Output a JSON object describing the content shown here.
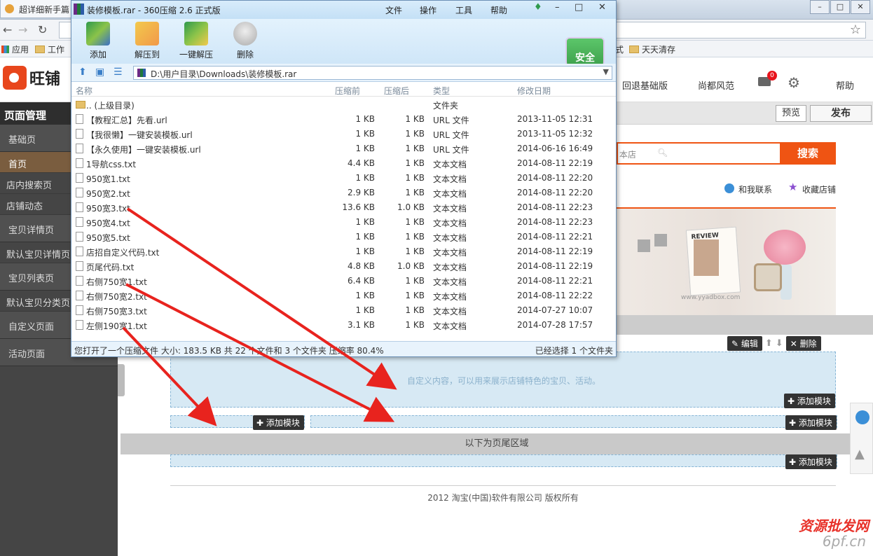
{
  "browser": {
    "tab_title": "超详细新手篇",
    "url": "",
    "bookmarks": [
      {
        "label": "应用"
      },
      {
        "label": "工作"
      },
      {
        "label": "式"
      },
      {
        "label": "天天清存"
      }
    ],
    "window_controls": [
      "–",
      "□",
      "✕"
    ]
  },
  "app": {
    "logo_text": "旺铺",
    "header_links": [
      "回退基础版",
      "尚都风范",
      "帮助"
    ],
    "mail_badge": "0",
    "preview_label": "预览",
    "publish_label": "发布"
  },
  "sidebar": {
    "title": "页面管理",
    "items": [
      {
        "label": "基础页",
        "kind": "group"
      },
      {
        "label": "首页",
        "kind": "active"
      },
      {
        "label": "店内搜索页",
        "kind": "sub"
      },
      {
        "label": "店铺动态",
        "kind": "sub"
      },
      {
        "label": "宝贝详情页",
        "kind": "group"
      },
      {
        "label": "默认宝贝详情页",
        "kind": "sub"
      },
      {
        "label": "宝贝列表页",
        "kind": "group"
      },
      {
        "label": "默认宝贝分类页",
        "kind": "sub"
      },
      {
        "label": "自定义页面",
        "kind": "group"
      },
      {
        "label": "活动页面",
        "kind": "group"
      }
    ]
  },
  "store": {
    "search_scope": "本店",
    "search_button": "搜索",
    "contact_label": "和我联系",
    "favorite_label": "收藏店铺",
    "banner_card_text": "REVIEW",
    "banner_watermark": "www.yyadbox.com"
  },
  "modules": {
    "edit_label": "编辑",
    "delete_label": "删除",
    "custom_text": "自定义内容，可以用来展示店铺特色的宝贝、活动。",
    "add_module_label": "添加模块",
    "footer_band": "以下为页尾区域",
    "copyright": "2012 淘宝(中国)软件有限公司 版权所有"
  },
  "watermark": {
    "line1": "资源批发网",
    "line2": "6pf.cn"
  },
  "zip": {
    "title": "装修模板.rar - 360压缩 2.6 正式版",
    "menu": [
      "文件",
      "操作",
      "工具",
      "帮助"
    ],
    "window_buttons": [
      "♦",
      "–",
      "□",
      "✕"
    ],
    "tools": [
      "添加",
      "解压到",
      "一键解压",
      "删除"
    ],
    "shield_label": "安全",
    "path": "D:\\用户目录\\Downloads\\装修模板.rar",
    "headers": {
      "name": "名称",
      "packed": "压缩前",
      "compressed": "压缩后",
      "type": "类型",
      "modified": "修改日期"
    },
    "rows": [
      {
        "name": ".. (上级目录)",
        "packed": "",
        "compressed": "",
        "type": "文件夹",
        "modified": "",
        "dir": true
      },
      {
        "name": "【教程汇总】先看.url",
        "packed": "1 KB",
        "compressed": "1 KB",
        "type": "URL 文件",
        "modified": "2013-11-05 12:31"
      },
      {
        "name": "【我很懒】一键安装模板.url",
        "packed": "1 KB",
        "compressed": "1 KB",
        "type": "URL 文件",
        "modified": "2013-11-05 12:32"
      },
      {
        "name": "【永久使用】一键安装模板.url",
        "packed": "1 KB",
        "compressed": "1 KB",
        "type": "URL 文件",
        "modified": "2014-06-16 16:49"
      },
      {
        "name": "1导航css.txt",
        "packed": "4.4 KB",
        "compressed": "1 KB",
        "type": "文本文档",
        "modified": "2014-08-11 22:19"
      },
      {
        "name": "950宽1.txt",
        "packed": "1 KB",
        "compressed": "1 KB",
        "type": "文本文档",
        "modified": "2014-08-11 22:20"
      },
      {
        "name": "950宽2.txt",
        "packed": "2.9 KB",
        "compressed": "1 KB",
        "type": "文本文档",
        "modified": "2014-08-11 22:20"
      },
      {
        "name": "950宽3.txt",
        "packed": "13.6 KB",
        "compressed": "1.0 KB",
        "type": "文本文档",
        "modified": "2014-08-11 22:23"
      },
      {
        "name": "950宽4.txt",
        "packed": "1 KB",
        "compressed": "1 KB",
        "type": "文本文档",
        "modified": "2014-08-11 22:23"
      },
      {
        "name": "950宽5.txt",
        "packed": "1 KB",
        "compressed": "1 KB",
        "type": "文本文档",
        "modified": "2014-08-11 22:21"
      },
      {
        "name": "店招自定义代码.txt",
        "packed": "1 KB",
        "compressed": "1 KB",
        "type": "文本文档",
        "modified": "2014-08-11 22:19"
      },
      {
        "name": "页尾代码.txt",
        "packed": "4.8 KB",
        "compressed": "1.0 KB",
        "type": "文本文档",
        "modified": "2014-08-11 22:19"
      },
      {
        "name": "右侧750宽1.txt",
        "packed": "6.4 KB",
        "compressed": "1 KB",
        "type": "文本文档",
        "modified": "2014-08-11 22:21"
      },
      {
        "name": "右侧750宽2.txt",
        "packed": "1 KB",
        "compressed": "1 KB",
        "type": "文本文档",
        "modified": "2014-08-11 22:22"
      },
      {
        "name": "右侧750宽3.txt",
        "packed": "1 KB",
        "compressed": "1 KB",
        "type": "文本文档",
        "modified": "2014-07-27 10:07"
      },
      {
        "name": "左侧190宽1.txt",
        "packed": "3.1 KB",
        "compressed": "1 KB",
        "type": "文本文档",
        "modified": "2014-07-28 17:57"
      }
    ],
    "status_left": "您打开了一个压缩文件 大小: 183.5 KB 共 22 个文件和 3 个文件夹 压缩率 80.4%",
    "status_right": "已经选择 1 个文件夹"
  },
  "annotation": {
    "arrow_color": "#e8231e"
  }
}
